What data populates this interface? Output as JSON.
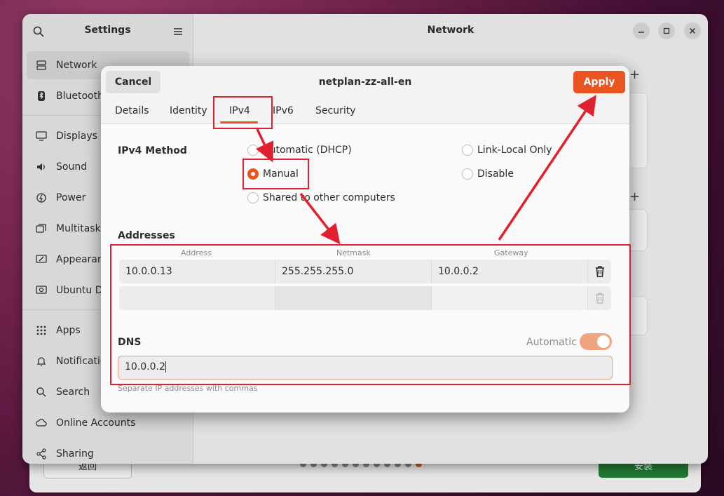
{
  "installer": {
    "back_label": "返回",
    "install_label": "安装",
    "step_count": 12,
    "current_step": 12
  },
  "settings": {
    "sidebar_title": "Settings",
    "main_title": "Network",
    "items": [
      {
        "label": "Network",
        "icon": "network-icon",
        "selected": true
      },
      {
        "label": "Bluetooth",
        "icon": "bluetooth-icon"
      },
      {
        "label": "Displays",
        "icon": "display-icon"
      },
      {
        "label": "Sound",
        "icon": "sound-icon"
      },
      {
        "label": "Power",
        "icon": "power-icon"
      },
      {
        "label": "Multitasking",
        "icon": "multitasking-icon"
      },
      {
        "label": "Appearance",
        "icon": "appearance-icon"
      },
      {
        "label": "Ubuntu Desktop",
        "icon": "ubuntu-desktop-icon"
      },
      {
        "label": "Apps",
        "icon": "apps-icon"
      },
      {
        "label": "Notifications",
        "icon": "bell-icon"
      },
      {
        "label": "Search",
        "icon": "search-icon"
      },
      {
        "label": "Online Accounts",
        "icon": "cloud-icon"
      },
      {
        "label": "Sharing",
        "icon": "share-icon"
      }
    ]
  },
  "dialog": {
    "title": "netplan-zz-all-en",
    "cancel_label": "Cancel",
    "apply_label": "Apply",
    "tabs": [
      "Details",
      "Identity",
      "IPv4",
      "IPv6",
      "Security"
    ],
    "active_tab": "IPv4",
    "method_label": "IPv4 Method",
    "methods": {
      "dhcp": "Automatic (DHCP)",
      "link_local": "Link-Local Only",
      "manual": "Manual",
      "disable": "Disable",
      "shared": "Shared to other computers"
    },
    "selected_method": "Manual",
    "addresses_label": "Addresses",
    "columns": [
      "Address",
      "Netmask",
      "Gateway"
    ],
    "rows": [
      {
        "address": "10.0.0.13",
        "netmask": "255.255.255.0",
        "gateway": "10.0.0.2"
      },
      {
        "address": "",
        "netmask": "",
        "gateway": ""
      }
    ],
    "dns_label": "DNS",
    "dns_automatic_label": "Automatic",
    "dns_value": "10.0.0.2",
    "dns_hint": "Separate IP addresses with commas"
  },
  "colors": {
    "accent": "#e95420",
    "annotation": "#e0202e",
    "install_green": "#26843a"
  }
}
